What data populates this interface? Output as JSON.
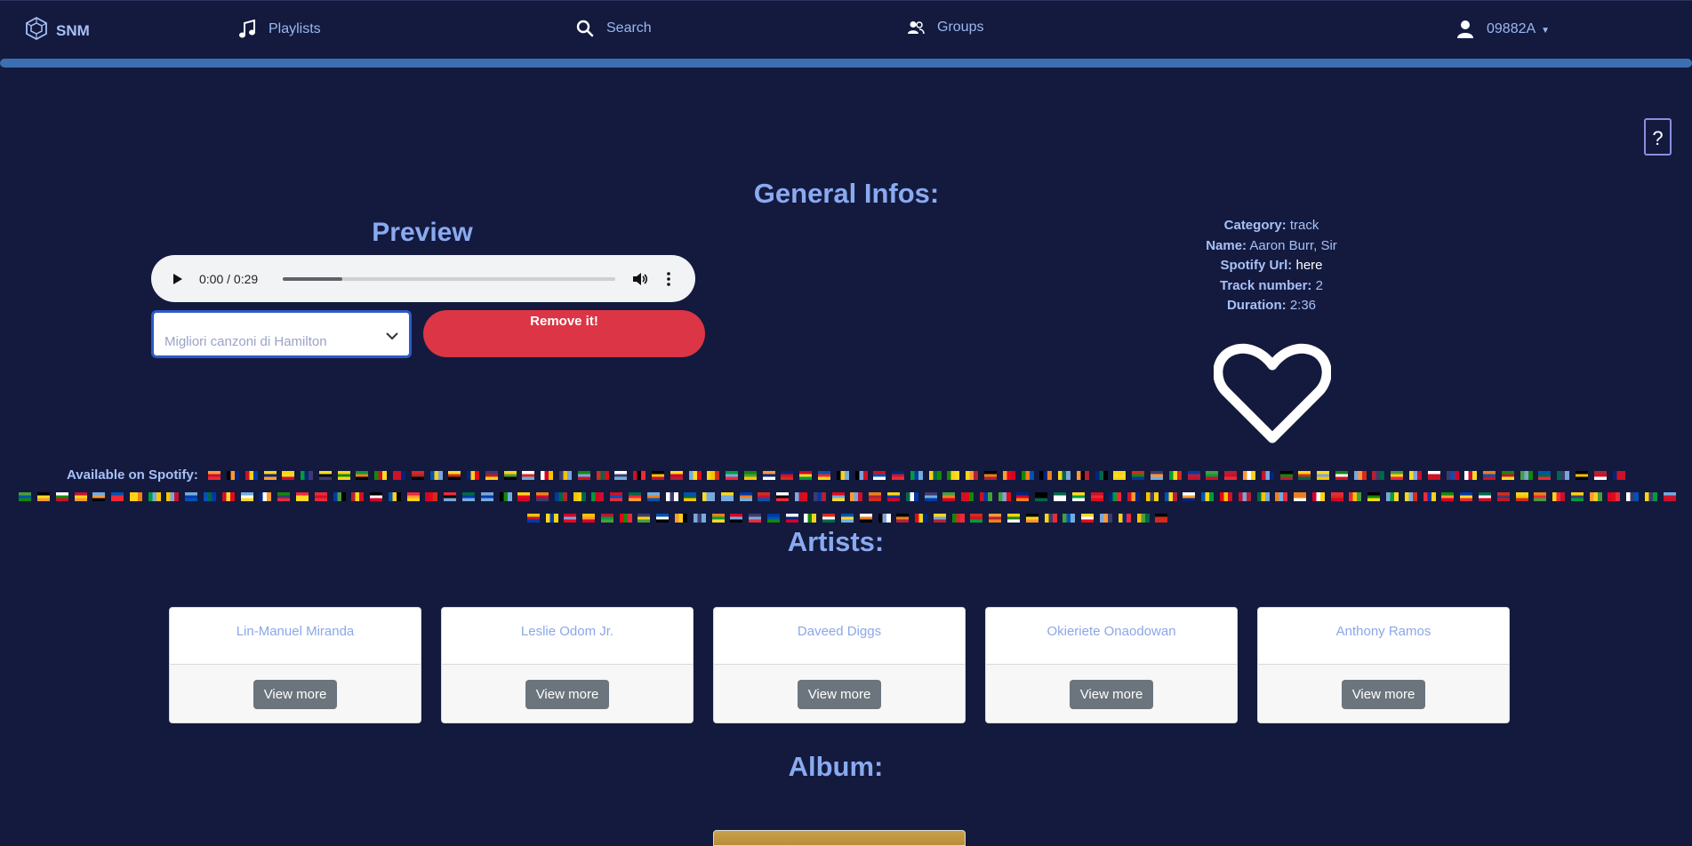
{
  "nav": {
    "brand": "SNM",
    "playlists": "Playlists",
    "search": "Search",
    "groups": "Groups",
    "user": "09882A"
  },
  "help_label": "?",
  "headings": {
    "general": "General Infos:",
    "preview": "Preview",
    "artists": "Artists:",
    "album": "Album:"
  },
  "audio": {
    "time": "0:00 / 0:29",
    "progress": 0.18
  },
  "playlist_select": {
    "value": "Migliori canzoni di Hamilton"
  },
  "remove_label": "Remove it!",
  "info": {
    "category_label": "Category:",
    "category": "track",
    "name_label": "Name:",
    "name": "Aaron Burr, Sir",
    "url_label": "Spotify Url:",
    "url": "here",
    "track_label": "Track number:",
    "track": "2",
    "duration_label": "Duration:",
    "duration": "2:36"
  },
  "available_label": "Available on Spotify:",
  "flag_palette": [
    "#74acdf",
    "#00247d",
    "#ed2939",
    "#fdda24",
    "#009c3b",
    "#d52b1e",
    "#ffffff",
    "#0039a6",
    "#ce1126",
    "#006847",
    "#fcd116",
    "#000000",
    "#ff9933",
    "#138808",
    "#c8102e",
    "#0052b4",
    "#f7d618",
    "#e30a17",
    "#7aa6d9",
    "#d80027",
    "#4a9d3f",
    "#f5c400",
    "#b22234",
    "#3c3b6e",
    "#ef7f1a"
  ],
  "artists": [
    {
      "name": "Lin-Manuel Miranda",
      "button": "View more"
    },
    {
      "name": "Leslie Odom Jr.",
      "button": "View more"
    },
    {
      "name": "Daveed Diggs",
      "button": "View more"
    },
    {
      "name": "Okieriete Onaodowan",
      "button": "View more"
    },
    {
      "name": "Anthony Ramos",
      "button": "View more"
    }
  ]
}
